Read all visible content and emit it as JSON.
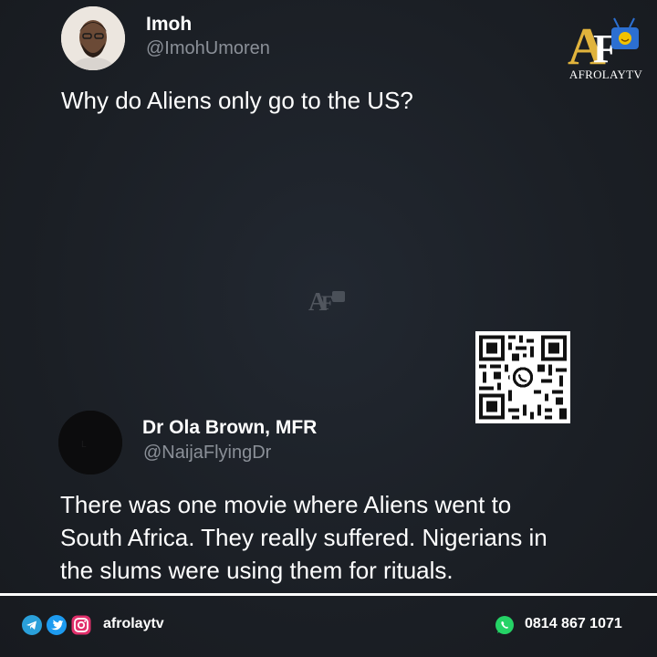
{
  "tweet1": {
    "name": "Imoh",
    "handle": "@ImohUmoren",
    "text": "Why do Aliens only go to the US?"
  },
  "tweet2": {
    "name": "Dr Ola Brown, MFR",
    "handle": "@NaijaFlyingDr",
    "text_lines": [
      "There was one movie where Aliens went to",
      "South Africa. They really suffered. Nigerians in",
      "the slums were using them for rituals."
    ]
  },
  "brand": {
    "name": "AfrolayTV",
    "color_gold": "#e0b33c",
    "color_blue": "#2c6fd1"
  },
  "footer": {
    "social_handle": "afrolaytv",
    "phone": "0814 867 1071",
    "icons": [
      "telegram-icon",
      "twitter-icon",
      "instagram-icon",
      "whatsapp-icon"
    ]
  }
}
